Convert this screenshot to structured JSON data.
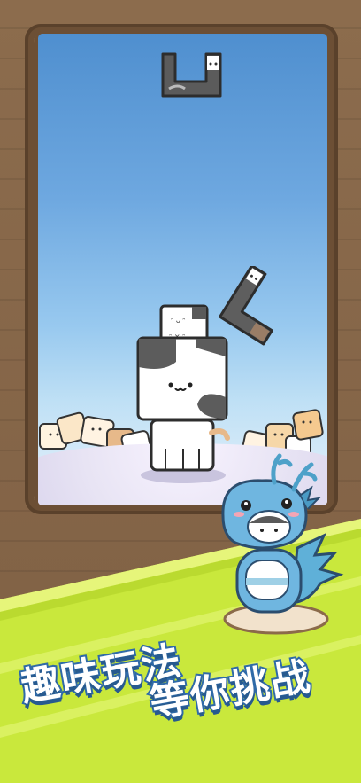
{
  "headline": {
    "line1": "趣味玩法",
    "line2": "等你挑战"
  },
  "colors": {
    "wood": "#8c6c4d",
    "sky_top": "#4f8fcf",
    "sky_bottom": "#e7f2fb",
    "grass": "#cdeb3f",
    "title_stroke": "#2f6aa8",
    "dragon": "#6fb6e0"
  },
  "scene": {
    "pieces": [
      {
        "name": "falling-l-block",
        "color": "dark-gray-cat"
      },
      {
        "name": "tilted-l-block",
        "color": "dark-gray-cat"
      },
      {
        "name": "small-white-cat-block",
        "color": "white-cat"
      },
      {
        "name": "big-cat-tower",
        "color": "white-black-cat"
      }
    ],
    "mascot": "blue-dragon-costume-cat"
  }
}
